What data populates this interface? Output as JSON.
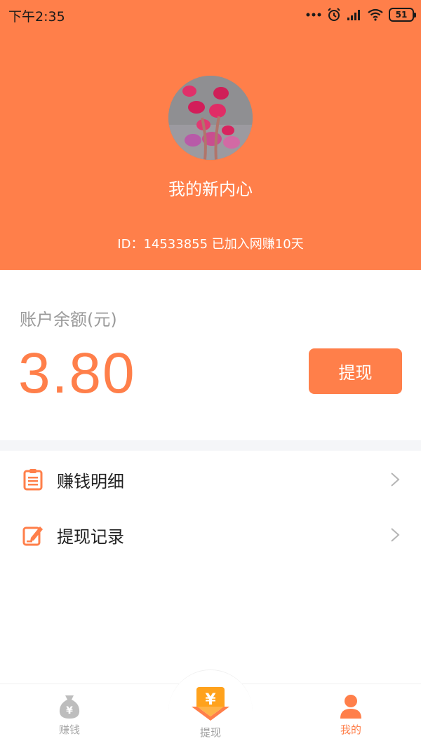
{
  "status_bar": {
    "time": "下午2:35",
    "battery": "51",
    "icons": [
      "more-dots-icon",
      "alarm-icon",
      "signal-icon",
      "wifi-icon",
      "battery-icon"
    ]
  },
  "profile": {
    "username": "我的新内心",
    "id_line": "ID：14533855 已加入网赚10天"
  },
  "account": {
    "balance_label": "账户余额(元)",
    "balance_value": "3.80",
    "withdraw_button": "提现"
  },
  "menu": [
    {
      "label": "赚钱明细",
      "icon": "clipboard-list-icon"
    },
    {
      "label": "提现记录",
      "icon": "edit-note-icon"
    }
  ],
  "tabbar": {
    "items": [
      {
        "label": "赚钱",
        "icon": "money-bag-icon",
        "active": false
      },
      {
        "label": "提现",
        "icon": "yuan-coin-icon",
        "active": false
      },
      {
        "label": "我的",
        "icon": "person-icon",
        "active": true
      }
    ]
  },
  "colors": {
    "accent": "#ff7f4a",
    "tab_inactive": "#a8a8a8",
    "divider": "#f5f6f8"
  }
}
